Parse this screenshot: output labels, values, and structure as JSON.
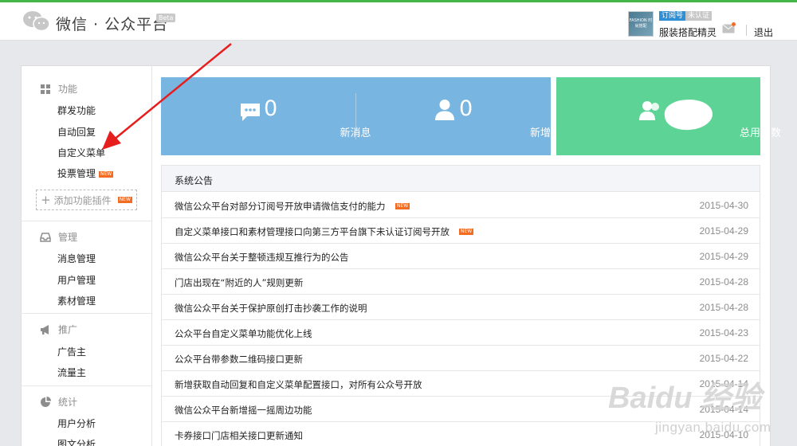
{
  "header": {
    "logo_text": "微信 · 公众平台",
    "beta": "Beta",
    "avatar_text": "FASHION 时尚搭配",
    "badge_subscription": "订阅号",
    "badge_unverified": "未认证",
    "account_name": "服装搭配精灵",
    "logout": "退出"
  },
  "sidebar": {
    "sections": [
      {
        "title": "功能",
        "icon": "grid-icon",
        "items": [
          {
            "label": "群发功能"
          },
          {
            "label": "自动回复"
          },
          {
            "label": "自定义菜单"
          },
          {
            "label": "投票管理",
            "new": "NEW"
          }
        ]
      },
      {
        "title": "管理",
        "icon": "inbox-icon",
        "items": [
          {
            "label": "消息管理"
          },
          {
            "label": "用户管理"
          },
          {
            "label": "素材管理"
          }
        ]
      },
      {
        "title": "推广",
        "icon": "megaphone-icon",
        "items": [
          {
            "label": "广告主"
          },
          {
            "label": "流量主"
          }
        ]
      },
      {
        "title": "统计",
        "icon": "pie-chart-icon",
        "items": [
          {
            "label": "用户分析"
          },
          {
            "label": "图文分析"
          }
        ]
      }
    ],
    "add_plugin": "添加功能插件",
    "add_plugin_new": "NEW"
  },
  "stats": {
    "new_messages": {
      "value": "0",
      "label": "新消息"
    },
    "new_users": {
      "value": "0",
      "label": "新增人数"
    },
    "total_users": {
      "value": "",
      "label": "总用户数"
    }
  },
  "notices": {
    "title": "系统公告",
    "new_tag": "NEW",
    "rows": [
      {
        "text": "微信公众平台对部分订阅号开放申请微信支付的能力",
        "date": "2015-04-30",
        "new": true
      },
      {
        "text": "自定义菜单接口和素材管理接口向第三方平台旗下未认证订阅号开放",
        "date": "2015-04-29",
        "new": true
      },
      {
        "text": "微信公众平台关于整顿违规互推行为的公告",
        "date": "2015-04-29"
      },
      {
        "text": "门店出现在“附近的人”规则更新",
        "date": "2015-04-28"
      },
      {
        "text": "微信公众平台关于保护原创打击抄袭工作的说明",
        "date": "2015-04-28"
      },
      {
        "text": "公众平台自定义菜单功能优化上线",
        "date": "2015-04-23"
      },
      {
        "text": "公众平台带参数二维码接口更新",
        "date": "2015-04-22"
      },
      {
        "text": "新增获取自动回复和自定义菜单配置接口，对所有公众号开放",
        "date": "2015-04-14"
      },
      {
        "text": "微信公众平台新增摇一摇周边功能",
        "date": "2015-04-14"
      },
      {
        "text": "卡券接口门店相关接口更新通知",
        "date": "2015-04-10"
      }
    ]
  },
  "watermark": {
    "text": "Baidu 经验",
    "sub": "jingyan.baidu.com"
  },
  "colors": {
    "accent_green": "#44b549",
    "stat_blue": "#78b5e1",
    "stat_green": "#5dd496",
    "new_tag": "#f36c21",
    "arrow": "#e61e1e"
  }
}
